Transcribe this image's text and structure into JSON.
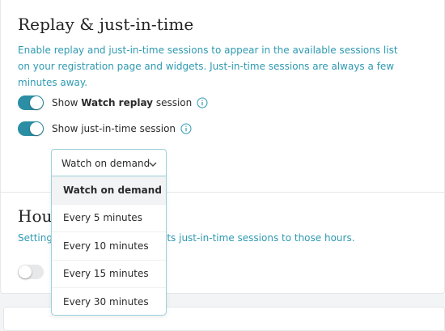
{
  "section": {
    "title": "Replay & just-in-time",
    "description": "Enable replay and just-in-time sessions to appear in the available sessions list on your registration page and widgets. Just-in-time sessions are always a few minutes away."
  },
  "toggles": [
    {
      "prefix": "Show ",
      "bold": "Watch replay",
      "suffix": " session",
      "state": "on"
    },
    {
      "text": "Show just-in-time session",
      "state": "on"
    }
  ],
  "dropdown": {
    "selected": "Watch on demand",
    "options": [
      "Watch on demand",
      "Every 5 minutes",
      "Every 10 minutes",
      "Every 15 minutes",
      "Every 30 minutes"
    ]
  },
  "hours": {
    "title_visible": "Hours",
    "desc_left_visible": "Setting",
    "desc_right_visible": "its just-in-time sessions to those hours.",
    "toggle_state": "off"
  },
  "colors": {
    "accent": "#2b8ea4",
    "link_text": "#2f9ab2",
    "dropdown_border": "#9ad1dd"
  },
  "icons": {
    "info": "info-circle-icon",
    "chevron": "chevron-down-icon"
  }
}
